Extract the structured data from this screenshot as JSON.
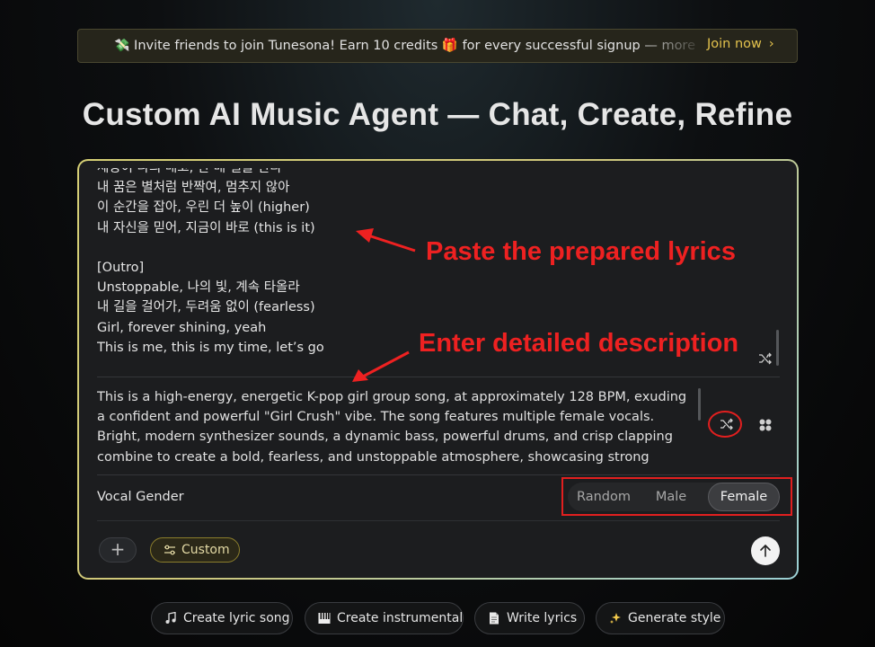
{
  "banner": {
    "emoji_left": "💸",
    "text": "Invite friends to join Tunesona! Earn 10 credits 🎁 for every successful signup — more",
    "link_label": "Join now",
    "link_chevron": "›"
  },
  "page_title": "Custom AI Music Agent — Chat, Create, Refine",
  "lyrics": {
    "lines": [
      "세상이 나의 배고, 한 배 일을 한다",
      "내 꿈은 별처럼 반짝여, 멈추지 않아",
      "이 순간을 잡아, 우린 더 높이 (higher)",
      "내 자신을 믿어, 지금이 바로 (this is it)",
      "",
      "[Outro]",
      "Unstoppable, 나의 빛, 계속 타올라",
      "내 길을 걸어가, 두려움 없이 (fearless)",
      "Girl, forever shining, yeah",
      "This is me, this is my time, let’s go"
    ]
  },
  "description": {
    "lines": [
      "This is a high-energy, energetic K-pop girl group song, at approximately 128 BPM, exuding",
      "a confident and powerful \"Girl Crush\" vibe. The song features multiple female vocals.",
      "Bright, modern synthesizer sounds, a dynamic bass, powerful drums, and crisp clapping",
      "combine to create a bold, fearless, and unstoppable atmosphere, showcasing strong"
    ]
  },
  "vocal_gender": {
    "label": "Vocal Gender",
    "options": [
      "Random",
      "Male",
      "Female"
    ],
    "selected": "Female"
  },
  "toolbar": {
    "add_label": "+",
    "custom_label": "Custom"
  },
  "annotations": {
    "lyrics_note": "Paste the prepared lyrics",
    "description_note": "Enter detailed description"
  },
  "chips": [
    {
      "label": "Create lyric song",
      "icon": "music-note-icon"
    },
    {
      "label": "Create instrumental",
      "icon": "piano-icon"
    },
    {
      "label": "Write lyrics",
      "icon": "document-icon"
    },
    {
      "label": "Generate style",
      "icon": "sparkles-icon"
    }
  ],
  "colors": {
    "accent_gold": "#e3c24d",
    "annotation_red": "#ee2121",
    "card_border_start": "#d5cf75",
    "card_border_end": "#9bd0d5"
  }
}
